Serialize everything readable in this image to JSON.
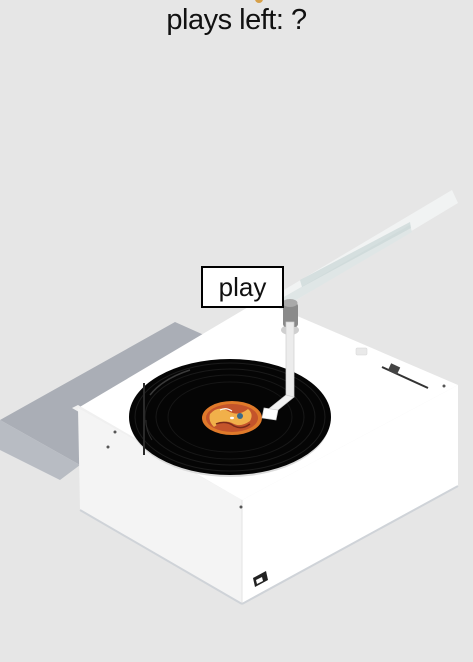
{
  "header": {
    "plays_left_text": "plays left: ?"
  },
  "controls": {
    "play_label": "play"
  },
  "icons": {
    "turntable": "record-player-illustration",
    "record": "vinyl-record-icon",
    "tonearm": "tonearm-icon",
    "slider": "speed-slider-icon"
  },
  "colors": {
    "background": "#e6e6e6",
    "body_white": "#ffffff",
    "record_black": "#000000",
    "label_orange": "#e07a2a"
  }
}
